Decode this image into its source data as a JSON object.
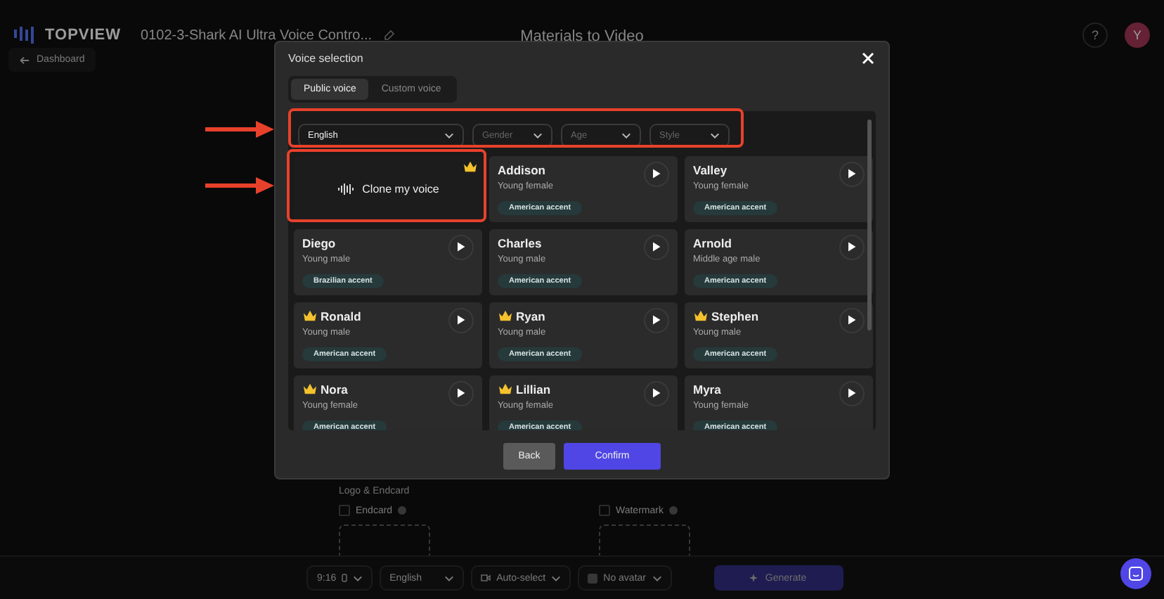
{
  "header": {
    "logo": "TOPVIEW",
    "project_title": "0102-3-Shark AI Ultra Voice Contro...",
    "page_title": "Materials to Video",
    "help": "?",
    "avatar": "Y"
  },
  "back_link": {
    "label": "Dashboard"
  },
  "logo_section": {
    "title": "Logo & Endcard",
    "options": [
      {
        "label": "Endcard",
        "checked": false
      },
      {
        "label": "Watermark",
        "checked": false
      }
    ]
  },
  "bottom_bar": {
    "ratio": "9:16",
    "language": "English",
    "camera": "Auto-select",
    "avatar": "No avatar",
    "generate": "Generate"
  },
  "dialog": {
    "title": "Voice selection",
    "tabs": [
      {
        "label": "Public voice",
        "selected": true
      },
      {
        "label": "Custom voice",
        "selected": false
      }
    ],
    "filters": [
      {
        "value": "English"
      },
      {
        "placeholder": "Gender"
      },
      {
        "placeholder": "Age"
      },
      {
        "placeholder": "Style"
      }
    ],
    "clone": {
      "label": "Clone my voice",
      "premium": true
    },
    "voices": [
      {
        "name": "Addison",
        "premium": false,
        "description": "Young female",
        "accent": "American accent"
      },
      {
        "name": "Valley",
        "premium": false,
        "description": "Young female",
        "accent": "American accent"
      },
      {
        "name": "Diego",
        "premium": false,
        "description": "Young male",
        "accent": "Brazilian accent"
      },
      {
        "name": "Charles",
        "premium": false,
        "description": "Young male",
        "accent": "American accent"
      },
      {
        "name": "Arnold",
        "premium": false,
        "description": "Middle age male",
        "accent": "American accent"
      },
      {
        "name": "Ronald",
        "premium": true,
        "description": "Young male",
        "accent": "American accent"
      },
      {
        "name": "Ryan",
        "premium": true,
        "description": "Young male",
        "accent": "American accent"
      },
      {
        "name": "Stephen",
        "premium": true,
        "description": "Young male",
        "accent": "American accent"
      },
      {
        "name": "Nora",
        "premium": true,
        "description": "Young female",
        "accent": "American accent"
      },
      {
        "name": "Lillian",
        "premium": true,
        "description": "Young female",
        "accent": "American accent"
      },
      {
        "name": "Myra",
        "premium": false,
        "description": "Young female",
        "accent": "American accent"
      }
    ],
    "back_button": "Back",
    "confirm_button": "Confirm"
  }
}
